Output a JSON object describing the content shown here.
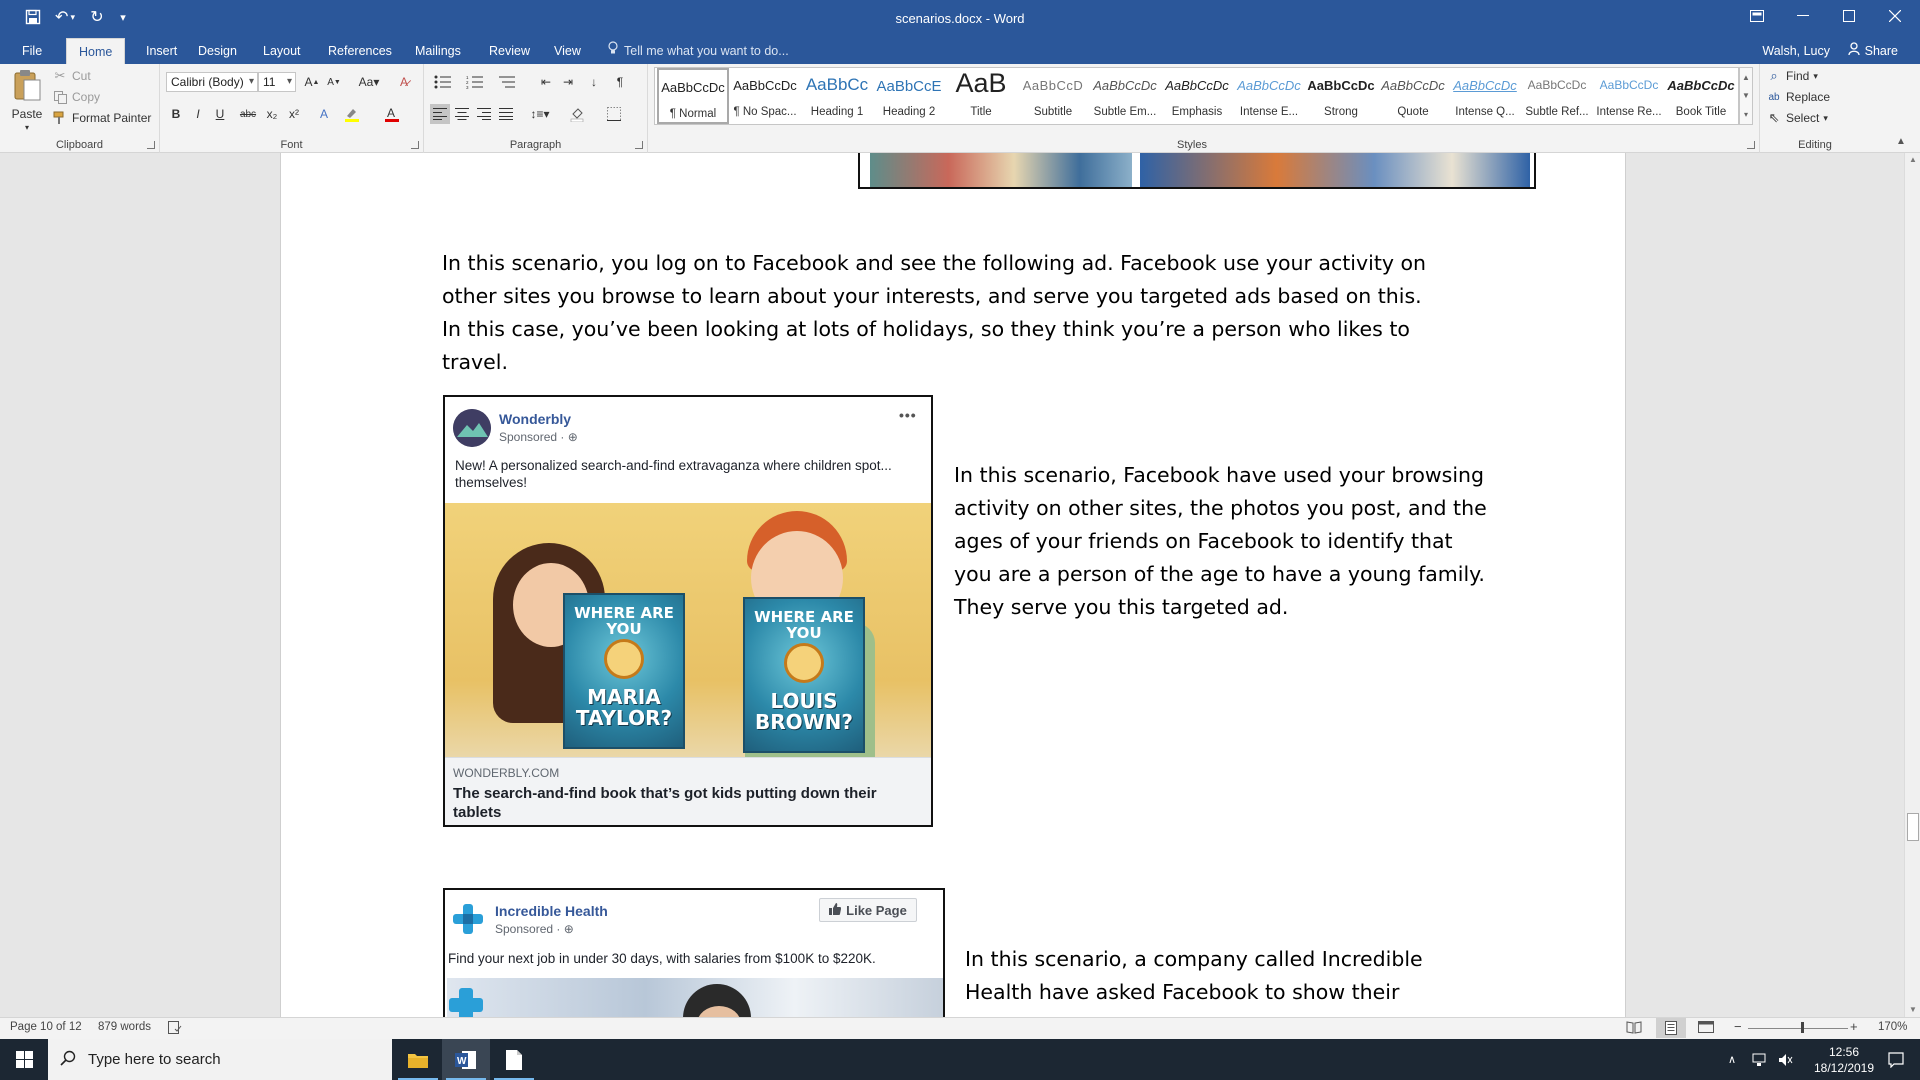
{
  "window": {
    "title": "scenarios.docx - Word",
    "quick_access": [
      "save-icon",
      "undo-icon",
      "redo-icon",
      "customize-icon"
    ]
  },
  "tabs": [
    "File",
    "Home",
    "Insert",
    "Design",
    "Layout",
    "References",
    "Mailings",
    "Review",
    "View"
  ],
  "active_tab": "Home",
  "tell_me": "Tell me what you want to do...",
  "account": {
    "user": "Walsh, Lucy",
    "share": "Share"
  },
  "clipboard": {
    "paste": "Paste",
    "cut": "Cut",
    "copy": "Copy",
    "format_painter": "Format Painter",
    "label": "Clipboard"
  },
  "font": {
    "name": "Calibri (Body)",
    "size": "11",
    "label": "Font",
    "buttons": [
      "B",
      "I",
      "U",
      "abc",
      "x₂",
      "x²"
    ]
  },
  "paragraph": {
    "label": "Paragraph"
  },
  "styles": {
    "label": "Styles",
    "items": [
      {
        "preview": "AaBbCcDc",
        "name": "¶ Normal"
      },
      {
        "preview": "AaBbCcDc",
        "name": "¶ No Spac..."
      },
      {
        "preview": "AaBbCc",
        "name": "Heading 1"
      },
      {
        "preview": "AaBbCcE",
        "name": "Heading 2"
      },
      {
        "preview": "AaB",
        "name": "Title"
      },
      {
        "preview": "AaBbCcD",
        "name": "Subtitle"
      },
      {
        "preview": "AaBbCcDc",
        "name": "Subtle Em..."
      },
      {
        "preview": "AaBbCcDc",
        "name": "Emphasis"
      },
      {
        "preview": "AaBbCcDc",
        "name": "Intense E..."
      },
      {
        "preview": "AaBbCcDc",
        "name": "Strong"
      },
      {
        "preview": "AaBbCcDc",
        "name": "Quote"
      },
      {
        "preview": "AaBbCcDc",
        "name": "Intense Q..."
      },
      {
        "preview": "AaBbCcDc",
        "name": "Subtle Ref..."
      },
      {
        "preview": "AaBbCcDc",
        "name": "Intense Re..."
      },
      {
        "preview": "AaBbCcDc",
        "name": "Book Title"
      }
    ]
  },
  "editing": {
    "label": "Editing",
    "find": "Find",
    "replace": "Replace",
    "select": "Select"
  },
  "doc": {
    "para1": "In this scenario, you log on to Facebook and see the following ad. Facebook use your activity on other sites you browse to learn about your interests, and serve you targeted ads based on this. In this case, you’ve been looking at lots of holidays, so they think you’re a person who likes to travel.",
    "para2": "In this scenario, Facebook have used your browsing activity on other sites, the photos you post, and the ages of your friends on Facebook to identify that you are a person of the age to have a young family. They serve you this targeted ad.",
    "para3": "In this scenario, a company called Incredible Health have asked Facebook to show their"
  },
  "ad1": {
    "name": "Wonderbly",
    "sponsored": "Sponsored · ",
    "more": "•••",
    "text": "New! A personalized search-and-find extravaganza where children spot... themselves!",
    "book1": {
      "q": "WHERE ARE YOU",
      "name": "MARIA TAYLOR?"
    },
    "book2": {
      "q": "WHERE ARE YOU",
      "name": "LOUIS BROWN?"
    },
    "domain": "WONDERBLY.COM",
    "headline": "The search-and-find book that’s got kids putting down their tablets"
  },
  "ad2": {
    "name": "Incredible Health",
    "sponsored": "Sponsored · ",
    "like": "Like Page",
    "text": "Find your next job in under 30 days, with salaries from $100K to $220K."
  },
  "status": {
    "page": "Page 10 of 12",
    "words": "879 words",
    "zoom": "170%"
  },
  "taskbar": {
    "search": "Type here to search",
    "time": "12:56",
    "date": "18/12/2019"
  }
}
